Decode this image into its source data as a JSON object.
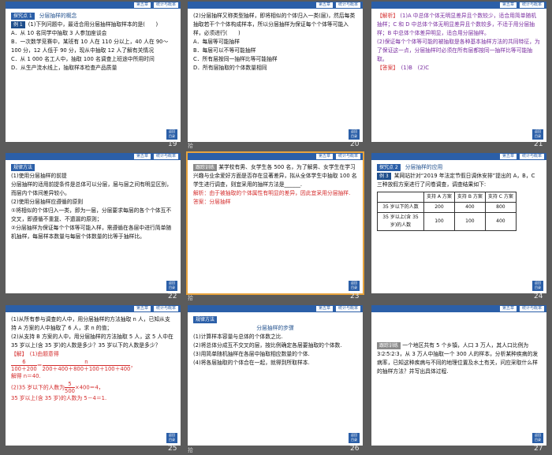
{
  "thumbnails": [
    {
      "num": "19",
      "note": ""
    },
    {
      "num": "20",
      "note": "拾"
    },
    {
      "num": "21",
      "note": ""
    },
    {
      "num": "22",
      "note": ""
    },
    {
      "num": "23",
      "note": "拾"
    },
    {
      "num": "24",
      "note": ""
    },
    {
      "num": "25",
      "note": ""
    },
    {
      "num": "26",
      "note": "拾"
    },
    {
      "num": "27",
      "note": ""
    }
  ],
  "header": {
    "chapter": "第五章",
    "section": "统计与概率"
  },
  "corner": "返回\n目录",
  "s19": {
    "tag": "探究点 1",
    "title": "分层抽样的概念",
    "ex_tag": "例 1",
    "q": "(1)下列问题中，最适合用分层抽样抽取样本的是(　　)",
    "a": "A．从 10 名同学中抽取 3 人参加座谈会",
    "b": "B．一次数学竞赛中，某班有 10 人在 110 分以上，40 人在 90～100 分，12 人低于 90 分，现从中抽取 12 人了解有关情况",
    "c": "C．从 1 000 名工人中，抽取 100 名调查上班途中所用时间",
    "d": "D．从生产流水线上，抽取样本检查产品质量"
  },
  "s20": {
    "p": "(2)分层抽样又称类型抽样，即将相似的个体归入一类(层)，然后每类抽取若干个个体构成样本，所以分层抽样为保证每个个体等可能入样，必须进行(　　)",
    "a": "A．每层等可能抽样",
    "b": "B．每层可以不等可能抽样",
    "c": "C．所有层按同一抽样比等可能抽样",
    "d": "D．所有层抽取的个体数量相同"
  },
  "s21": {
    "jiexi": "【解析】",
    "t1": "(1)A 中总体个体无明显差异且个数较少，适合用简单随机抽样；C 和 D 中总体个体无明显差异且个数较多，不适于用分层抽样；B 中总体个体差异明显，适合用分层抽样。",
    "t2": "(2)保证每个个体等可能的被抽取是各种基本抽样方法的共同特征，为了保证这一点，分层抽样时必须在所有层都按同一抽样比等可能抽取。",
    "daan": "【答案】",
    "ans": "(1)B　(2)C"
  },
  "s22": {
    "tag": "规律方法",
    "l1": "(1)使用分层抽样的前提",
    "l2": "分层抽样的适用前提条件是总体可以分层，层与层之间有明显区别，而层内个体间差异较小。",
    "l3": "(2)使用分层抽样应遵循的原则",
    "l4": "①将相似的个体归入一类，即为一层，分层要求每层的各个个体互不交叉，即遵循不重复、不遗漏的原则；",
    "l5": "②分层抽样为保证每个个体等可能入样，需遵循在各层中进行简单随机抽样，每层样本数量与每层个体数量的比等于抽样比。"
  },
  "s23": {
    "tag": "跟踪训练",
    "p": "某学校有男、女学生各 500 名，为了解男、女学生在学习兴趣与业余爱好方面是否存在显著差异，拟从全体学生中抽取 100 名学生进行调查，则宜采用的抽样方法是______.",
    "jiexi_label": "解析：",
    "jiexi": "由于被抽取的个体属性有明显的差异，因此宜采用分层抽样.",
    "ans_label": "答案：",
    "ans": "分层抽样"
  },
  "s24": {
    "tag": "探究点 2",
    "title": "分层抽样的应用",
    "ex_tag": "例 3",
    "p": "某网站针对“2019 年法定节假日调休安排”提出的 A，B，C 三种放假方案进行了问卷调查，调查结果如下:",
    "table": {
      "head": [
        "",
        "支持 A 方案",
        "支持 B 方案",
        "支持 C 方案"
      ],
      "rows": [
        [
          "35 岁以下的人数",
          "200",
          "400",
          "800"
        ],
        [
          "35 岁以上(含 35 岁)的人数",
          "100",
          "100",
          "400"
        ]
      ]
    }
  },
  "s25": {
    "l1": "(1)从所有参与调查的人中，用分层抽样的方法抽取 n 人，已知从支持 A 方案的人中抽取了 6 人，求 n 的值；",
    "l2": "(2)从支持 B 方案的人中，用分层抽样的方法抽取 5 人，这 5 人中在 35 岁以上(含 35 岁)的人数是多少？35 岁以下的人数是多少？",
    "jie": "【解】",
    "s1": "(1)由题意得",
    "f_num": "6",
    "f_den": "100＋200",
    "f_eq": "＝",
    "f2_num": "n",
    "f2_den": "200＋400＋800＋100＋100＋400",
    "f_tail": "，",
    "s2": "解得 n＝40.",
    "s3a": "(2)35 岁以下的人数为",
    "f3_num": "5",
    "f3_den": "500",
    "s3b": "×400＝4，",
    "s4": "35 岁以上(含 35 岁)的人数为 5－4＝1."
  },
  "s26": {
    "tag": "规律方法",
    "title": "分层抽样的步骤",
    "l1": "(1)计算样本容量与总体的个体数之比.",
    "l2": "(2)将总体分成互不交叉的层，按比例确定各层要抽取的个体数.",
    "l3": "(3)用简单随机抽样在各层中抽取相应数量的个体.",
    "l4": "(4)将各层抽取的个体合在一起，就得到所取样本."
  },
  "s27": {
    "tag": "跟踪训练",
    "p": "一个地区共有 5 个乡镇，人口 3 万人，其人口比例为 3∶2∶5∶2∶3，从 3 万人中抽取一个 300 人的样本，分析某种疾病的发病率，已知这种疾病与不同的地理位置及水土有关，问应采取什么样的抽样方法？并写出具体过程."
  }
}
